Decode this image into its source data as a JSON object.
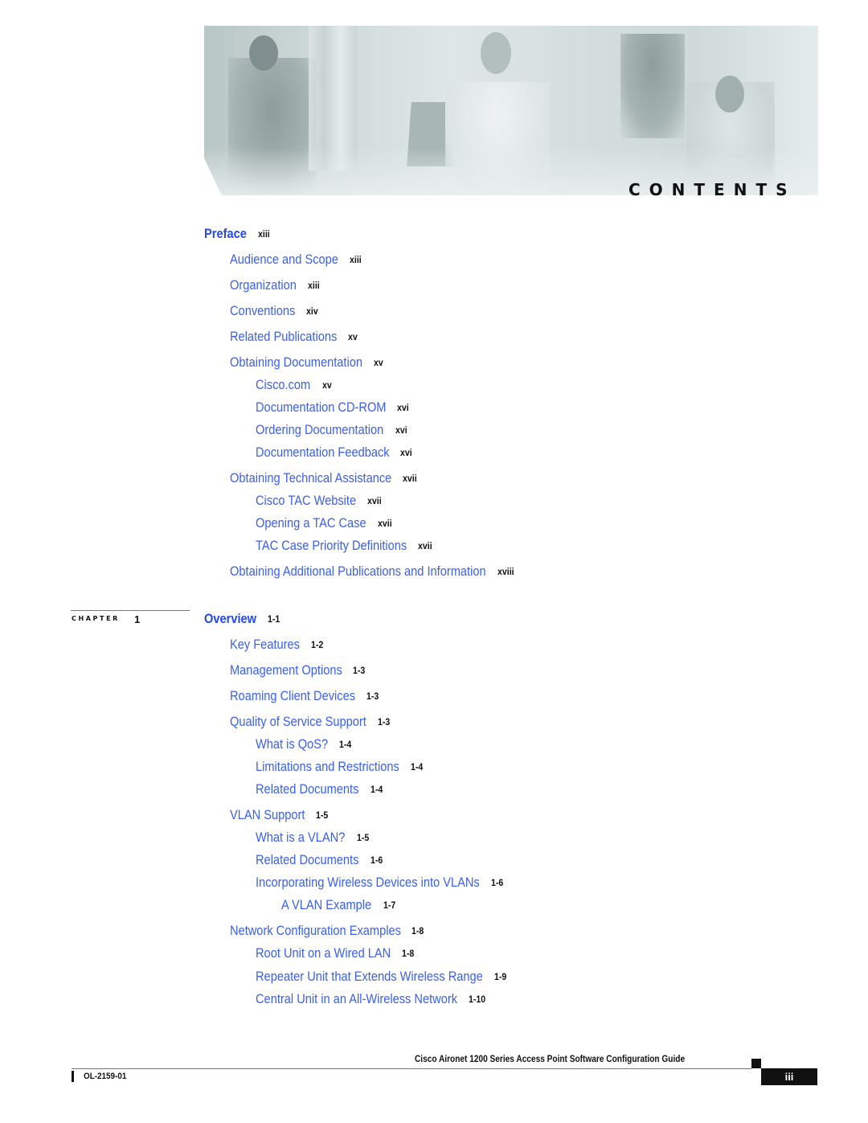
{
  "header": {
    "banner_alt": "photo-of-four-professionals-with-laptop",
    "contents_label": "CONTENTS"
  },
  "preface": {
    "title": "Preface",
    "page": "xiii",
    "entries": [
      {
        "level": 1,
        "title": "Audience and Scope",
        "page": "xiii"
      },
      {
        "level": 1,
        "title": "Organization",
        "page": "xiii"
      },
      {
        "level": 1,
        "title": "Conventions",
        "page": "xiv"
      },
      {
        "level": 1,
        "title": "Related Publications",
        "page": "xv"
      },
      {
        "level": 1,
        "title": "Obtaining Documentation",
        "page": "xv"
      },
      {
        "level": 2,
        "title": "Cisco.com",
        "page": "xv"
      },
      {
        "level": 2,
        "title": "Documentation CD-ROM",
        "page": "xvi"
      },
      {
        "level": 2,
        "title": "Ordering Documentation",
        "page": "xvi"
      },
      {
        "level": 2,
        "title": "Documentation Feedback",
        "page": "xvi"
      },
      {
        "level": 1,
        "title": "Obtaining Technical Assistance",
        "page": "xvii"
      },
      {
        "level": 2,
        "title": "Cisco TAC Website",
        "page": "xvii"
      },
      {
        "level": 2,
        "title": "Opening a TAC Case",
        "page": "xvii"
      },
      {
        "level": 2,
        "title": "TAC Case Priority Definitions",
        "page": "xvii"
      },
      {
        "level": 1,
        "title": "Obtaining Additional Publications and Information",
        "page": "xviii"
      }
    ]
  },
  "chapter1": {
    "chapter_label": "CHAPTER",
    "chapter_number": "1",
    "title": "Overview",
    "page": "1-1",
    "entries": [
      {
        "level": 1,
        "title": "Key Features",
        "page": "1-2"
      },
      {
        "level": 1,
        "title": "Management Options",
        "page": "1-3"
      },
      {
        "level": 1,
        "title": "Roaming Client Devices",
        "page": "1-3"
      },
      {
        "level": 1,
        "title": "Quality of Service Support",
        "page": "1-3"
      },
      {
        "level": 2,
        "title": "What is QoS?",
        "page": "1-4"
      },
      {
        "level": 2,
        "title": "Limitations and Restrictions",
        "page": "1-4"
      },
      {
        "level": 2,
        "title": "Related Documents",
        "page": "1-4"
      },
      {
        "level": 1,
        "title": "VLAN Support",
        "page": "1-5"
      },
      {
        "level": 2,
        "title": "What is a VLAN?",
        "page": "1-5"
      },
      {
        "level": 2,
        "title": "Related Documents",
        "page": "1-6"
      },
      {
        "level": 2,
        "title": "Incorporating Wireless Devices into VLANs",
        "page": "1-6"
      },
      {
        "level": 3,
        "title": "A VLAN Example",
        "page": "1-7"
      },
      {
        "level": 1,
        "title": "Network Configuration Examples",
        "page": "1-8"
      },
      {
        "level": 2,
        "title": "Root Unit on a Wired LAN",
        "page": "1-8"
      },
      {
        "level": 2,
        "title": "Repeater Unit that Extends Wireless Range",
        "page": "1-9"
      },
      {
        "level": 2,
        "title": "Central Unit in an All-Wireless Network",
        "page": "1-10"
      }
    ]
  },
  "footer": {
    "guide_title": "Cisco Aironet 1200 Series Access Point Software Configuration Guide",
    "page_number": "iii",
    "doc_number": "OL-2159-01"
  },
  "colors": {
    "link": "#3a5ff0",
    "heading_link": "#2448ee",
    "text": "#111111"
  }
}
